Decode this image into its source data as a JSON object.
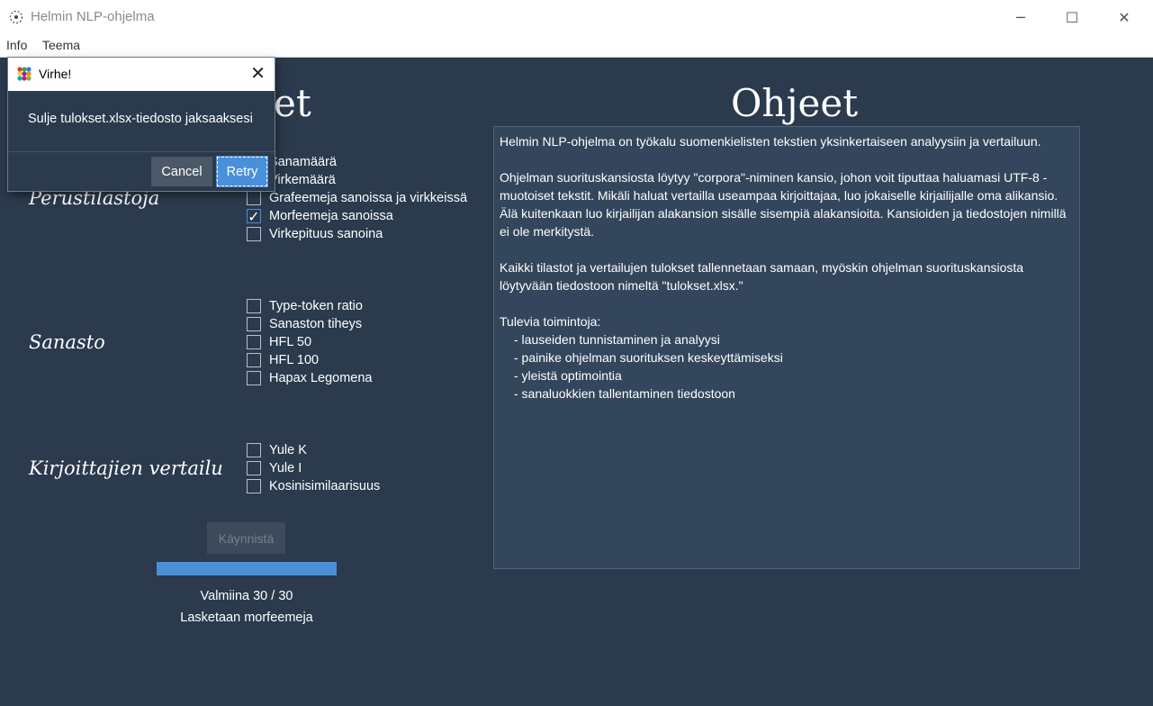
{
  "window": {
    "title": "Helmin NLP-ohjelma",
    "controls": {
      "minimize": "─",
      "maximize": "☐",
      "close": "✕"
    }
  },
  "menu": [
    "Info",
    "Teema"
  ],
  "headings": {
    "left": "kset",
    "right": "Ohjeet"
  },
  "sections": [
    {
      "label": "Perustilastoja",
      "options": [
        {
          "label": "Sanamäärä",
          "checked": false
        },
        {
          "label": "Virkemäärä",
          "checked": false
        },
        {
          "label": "Grafeemeja sanoissa ja virkkeissä",
          "checked": false
        },
        {
          "label": "Morfeemeja sanoissa",
          "checked": true
        },
        {
          "label": "Virkepituus sanoina",
          "checked": false
        }
      ]
    },
    {
      "label": "Sanasto",
      "options": [
        {
          "label": "Type-token ratio",
          "checked": false
        },
        {
          "label": "Sanaston tiheys",
          "checked": false
        },
        {
          "label": "HFL 50",
          "checked": false
        },
        {
          "label": "HFL 100",
          "checked": false
        },
        {
          "label": "Hapax Legomena",
          "checked": false
        }
      ]
    },
    {
      "label": "Kirjoittajien vertailu",
      "options": [
        {
          "label": "Yule K",
          "checked": false
        },
        {
          "label": "Yule I",
          "checked": false
        },
        {
          "label": "Kosinisimilaarisuus",
          "checked": false
        }
      ]
    }
  ],
  "start_button": "Käynnistä",
  "progress": {
    "fraction": 1.0,
    "status": "Valmiina 30 / 30",
    "task": "Lasketaan morfeemeja"
  },
  "instructions": {
    "paragraphs": [
      "Helmin NLP-ohjelma on työkalu suomenkielisten tekstien yksinkertaiseen analyysiin ja vertailuun.",
      "Ohjelman suorituskansiosta löytyy \"corpora\"-niminen kansio, johon voit tiputtaa haluamasi UTF-8 -muotoiset tekstit. Mikäli haluat vertailla useampaa kirjoittajaa, luo jokaiselle kirjailijalle oma alikansio. Älä kuitenkaan luo kirjailijan alakansion sisälle sisempiä alakansioita. Kansioiden ja tiedostojen nimillä ei ole merkitystä.",
      "Kaikki tilastot ja vertailujen tulokset tallennetaan samaan, myöskin ohjelman suorituskansiosta löytyvään tiedostoon nimeltä \"tulokset.xlsx.\"",
      "Tulevia toimintoja:"
    ],
    "upcoming": [
      "- lauseiden tunnistaminen ja analyysi",
      "- painike ohjelman suorituksen keskeyttämiseksi",
      "- yleistä optimointia",
      "- sanaluokkien tallentaminen tiedostoon"
    ]
  },
  "dialog": {
    "title": "Virhe!",
    "message": "Sulje tulokset.xlsx-tiedosto jaksaaksesi",
    "cancel": "Cancel",
    "retry": "Retry",
    "close": "✕"
  }
}
